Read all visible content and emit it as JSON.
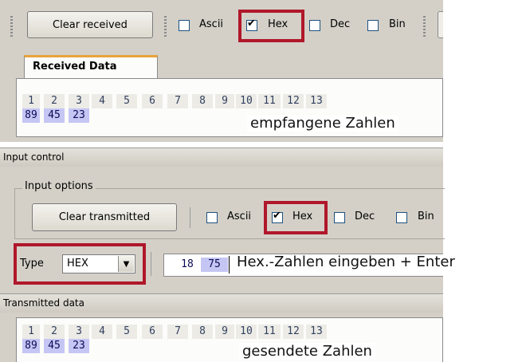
{
  "toolbar": {
    "clear_received_label": "Clear received",
    "ascii_label": "Ascii",
    "hex_label": "Hex",
    "dec_label": "Dec",
    "bin_label": "Bin",
    "ascii_checked": false,
    "hex_checked": true,
    "dec_checked": false,
    "bin_checked": false
  },
  "received": {
    "tab_label": "Received Data",
    "indices": [
      "1",
      "2",
      "3",
      "4",
      "5",
      "6",
      "7",
      "8",
      "9",
      "10",
      "11",
      "12",
      "13"
    ],
    "values": [
      "89",
      "45",
      "23"
    ],
    "annotation": "empfangene Zahlen"
  },
  "input_control": {
    "title": "Input control",
    "options_title": "Input options",
    "clear_transmitted_label": "Clear transmitted",
    "ascii_label": "Ascii",
    "hex_label": "Hex",
    "dec_label": "Dec",
    "bin_label": "Bin",
    "ascii_checked": false,
    "hex_checked": true,
    "dec_checked": false,
    "bin_checked": false,
    "type_label": "Type",
    "type_value": "HEX",
    "typed_values": [
      "18",
      "75"
    ],
    "annotation": "Hex.-Zahlen eingeben + Enter"
  },
  "transmitted": {
    "title": "Transmitted data",
    "indices": [
      "1",
      "2",
      "3",
      "4",
      "5",
      "6",
      "7",
      "8",
      "9",
      "10",
      "11",
      "12",
      "13"
    ],
    "values": [
      "89",
      "45",
      "23"
    ],
    "annotation": "gesendete Zahlen"
  },
  "colors": {
    "highlight_border": "#b0172a",
    "value_cell": "#c6c6f4",
    "panel": "#d4d0c8"
  }
}
